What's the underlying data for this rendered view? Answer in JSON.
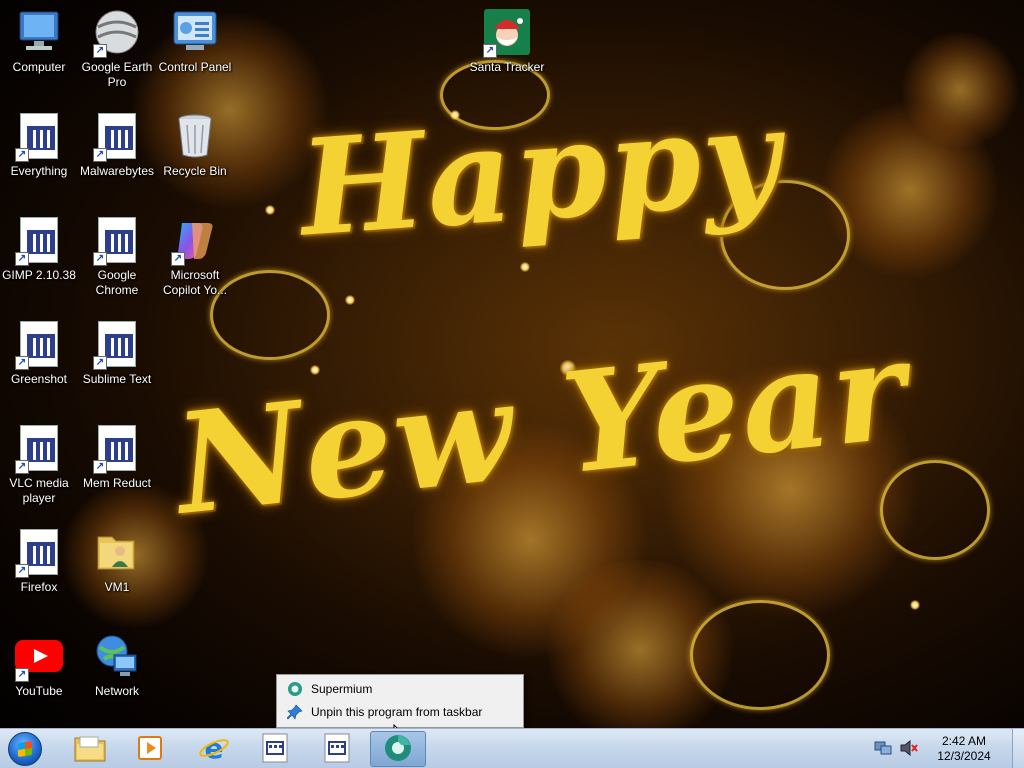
{
  "desktop": {
    "icons": [
      {
        "label": "Computer",
        "icon": "computer-icon",
        "shortcut": false
      },
      {
        "label": "Google Earth Pro",
        "icon": "google-earth-icon",
        "shortcut": true
      },
      {
        "label": "Control Panel",
        "icon": "control-panel-icon",
        "shortcut": false
      },
      {
        "label": "Santa Tracker",
        "icon": "santa-icon",
        "shortcut": true
      },
      {
        "label": "Everything",
        "icon": "app-icon",
        "shortcut": true
      },
      {
        "label": "Malwarebytes",
        "icon": "app-icon",
        "shortcut": true
      },
      {
        "label": "Recycle Bin",
        "icon": "recycle-bin-icon",
        "shortcut": false
      },
      {
        "label": "GIMP 2.10.38",
        "icon": "app-icon",
        "shortcut": true
      },
      {
        "label": "Google Chrome",
        "icon": "app-icon",
        "shortcut": true
      },
      {
        "label": "Microsoft Copilot Yo...",
        "icon": "copilot-icon",
        "shortcut": true
      },
      {
        "label": "Greenshot",
        "icon": "app-icon",
        "shortcut": true
      },
      {
        "label": "Sublime Text",
        "icon": "app-icon",
        "shortcut": true
      },
      {
        "label": "VLC media player",
        "icon": "app-icon",
        "shortcut": true
      },
      {
        "label": "Mem Reduct",
        "icon": "app-icon",
        "shortcut": true
      },
      {
        "label": "Firefox",
        "icon": "app-icon",
        "shortcut": true
      },
      {
        "label": "VM1",
        "icon": "folder-user-icon",
        "shortcut": false
      },
      {
        "label": "YouTube",
        "icon": "youtube-icon",
        "shortcut": true
      },
      {
        "label": "Network",
        "icon": "network-icon",
        "shortcut": false
      }
    ]
  },
  "wallpaper": {
    "line1": "Happy",
    "line2": "New Year"
  },
  "context_menu": {
    "items": [
      {
        "label": "Supermium",
        "icon": "supermium-icon"
      },
      {
        "label": "Unpin this program from taskbar",
        "icon": "unpin-icon"
      }
    ]
  },
  "taskbar": {
    "pinned": [
      {
        "name": "file-explorer",
        "icon": "folder-icon"
      },
      {
        "name": "media-player",
        "icon": "media-player-icon"
      },
      {
        "name": "internet-explorer",
        "icon": "ie-icon"
      },
      {
        "name": "app-1",
        "icon": "app-icon"
      },
      {
        "name": "app-2",
        "icon": "app-icon"
      },
      {
        "name": "supermium",
        "icon": "supermium-icon",
        "active": true
      }
    ],
    "tray_icons": [
      "network-tray-icon",
      "volume-muted-icon"
    ],
    "time": "2:42 AM",
    "date": "12/3/2024"
  },
  "colors": {
    "taskbar_top": "#dfe9f5",
    "taskbar_bottom": "#b7cbe4",
    "greeting_gold": "#f5d234",
    "menu_bg": "#f0f0f0"
  }
}
